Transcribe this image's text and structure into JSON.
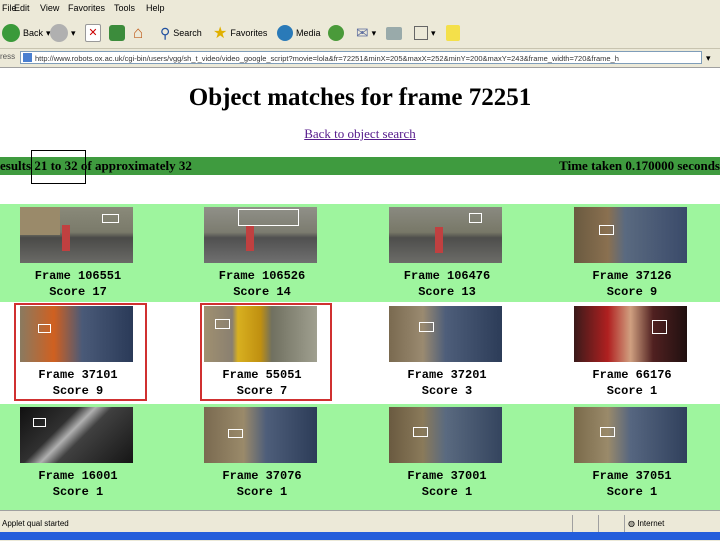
{
  "menu": {
    "items": [
      "File",
      "Edit",
      "View",
      "Favorites",
      "Tools",
      "Help"
    ]
  },
  "toolbar": {
    "back_label": "Back",
    "search_label": "Search",
    "favorites_label": "Favorites",
    "media_label": "Media"
  },
  "address": {
    "label": "ress",
    "url": "http://www.robots.ox.ac.uk/cgi-bin/users/vgg/sh_t_video/video_google_script?movie=lola&fr=72251&minX=205&maxX=252&minY=200&maxY=243&frame_width=720&frame_h"
  },
  "page": {
    "title": "Object matches for frame 72251",
    "back_link": "Back to object search",
    "results_text_prefix": "esults ",
    "results_range": "21 to 32",
    "results_text_suffix": " of approximately 32",
    "time_text": "Time taken 0.170000 seconds"
  },
  "rows": [
    {
      "bg": "#9ef59e",
      "cells": [
        {
          "frame": "Frame 106551",
          "score": "Score 17"
        },
        {
          "frame": "Frame 106526",
          "score": "Score 14"
        },
        {
          "frame": "Frame 106476",
          "score": "Score 13"
        },
        {
          "frame": "Frame 37126",
          "score": "Score 9"
        }
      ]
    },
    {
      "bg": "#ffffff",
      "cells": [
        {
          "frame": "Frame 37101",
          "score": "Score 9"
        },
        {
          "frame": "Frame 55051",
          "score": "Score 7"
        },
        {
          "frame": "Frame 37201",
          "score": "Score 3"
        },
        {
          "frame": "Frame 66176",
          "score": "Score 1"
        }
      ]
    },
    {
      "bg": "#9ef59e",
      "cells": [
        {
          "frame": "Frame 16001",
          "score": "Score 1"
        },
        {
          "frame": "Frame 37076",
          "score": "Score 1"
        },
        {
          "frame": "Frame 37001",
          "score": "Score 1"
        },
        {
          "frame": "Frame 37051",
          "score": "Score 1"
        }
      ]
    }
  ],
  "status": {
    "left": "Applet qual started",
    "zone": "Internet"
  },
  "colors": {
    "result_bar": "#3f9b3f",
    "row_green": "#9ef59e",
    "highlight_frame": "#d03030",
    "link": "#551a8b"
  }
}
